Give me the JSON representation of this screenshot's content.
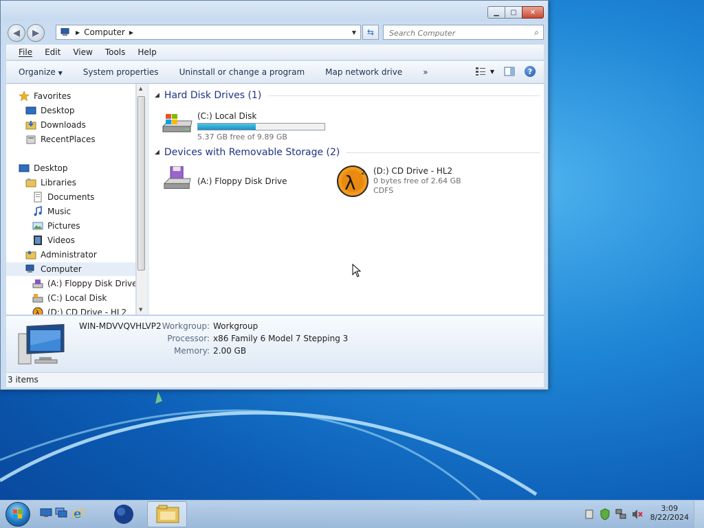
{
  "window": {
    "address_segment": "Computer",
    "search_placeholder": "Search Computer",
    "menu": [
      "File",
      "Edit",
      "View",
      "Tools",
      "Help"
    ],
    "toolbar": [
      "Organize",
      "System properties",
      "Uninstall or change a program",
      "Map network drive"
    ],
    "more_symbol": "»"
  },
  "nav": {
    "favorites": "Favorites",
    "desktop_fav": "Desktop",
    "downloads": "Downloads",
    "recent_places": "RecentPlaces",
    "desktop": "Desktop",
    "libraries": "Libraries",
    "documents": "Documents",
    "music": "Music",
    "pictures": "Pictures",
    "videos": "Videos",
    "administrator": "Administrator",
    "computer": "Computer",
    "floppy": "(A:) Floppy Disk Drive",
    "local_disk": "(C:) Local Disk",
    "cd_drive": "(D:) CD Drive - HL2"
  },
  "groups": {
    "hard_disks": "Hard Disk Drives (1)",
    "removable": "Devices with Removable Storage (2)"
  },
  "drives": {
    "c": {
      "name": "(C:) Local Disk",
      "free": "5.37 GB free of 9.89 GB",
      "used_fraction": 0.457
    },
    "a": {
      "name": "(A:) Floppy Disk Drive"
    },
    "d": {
      "name": "(D:) CD Drive - HL2",
      "free": "0 bytes free of 2.64 GB",
      "fs": "CDFS"
    }
  },
  "details": {
    "computer_name": "WIN-MDVVQVHLVP2",
    "workgroup_label": "Workgroup:",
    "workgroup": "Workgroup",
    "processor_label": "Processor:",
    "processor": "x86 Family 6 Model 7 Stepping 3",
    "memory_label": "Memory:",
    "memory": "2.00 GB"
  },
  "status": {
    "items": "3 items"
  },
  "taskbar": {
    "time": "3:09",
    "date": "8/22/2024"
  }
}
